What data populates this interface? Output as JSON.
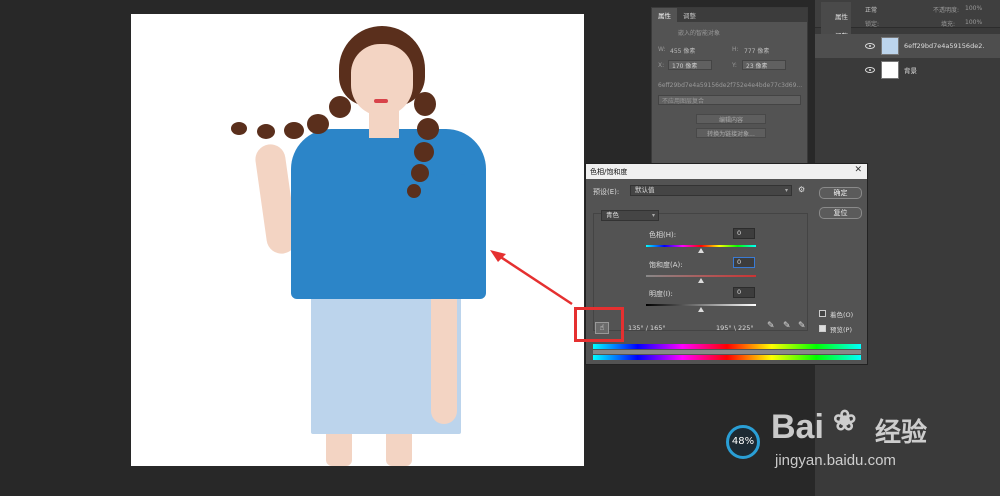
{
  "properties_panel": {
    "tabs": [
      "属性",
      "调整"
    ],
    "smart_object_label": "嵌入的智能对象",
    "w_label": "W:",
    "w_value": "455 像素",
    "h_label": "H:",
    "h_value": "777 像素",
    "x_label": "X:",
    "x_value": "170 像素",
    "y_label": "Y:",
    "y_value": "23 像素",
    "filename": "6eff29bd7e4a59156de2f752e4e4bde77c3d69...",
    "comp_placeholder": "不应用图层复合",
    "edit_contents": "编辑内容",
    "convert_layers": "转换为链接对象..."
  },
  "layers_panel": {
    "blend_mode": "正常",
    "opacity_label": "不透明度:",
    "opacity_value": "100%",
    "lock_label": "锁定:",
    "fill_label": "填充:",
    "fill_value": "100%",
    "layers": [
      {
        "name": "6eff29bd7e4a59156de2...",
        "selected": true
      },
      {
        "name": "背景",
        "selected": false
      }
    ],
    "adjust_tabs": [
      "属性",
      "调整"
    ]
  },
  "dialog": {
    "title": "色相/饱和度",
    "preset_label": "预设(E):",
    "preset_value": "默认值",
    "ok": "确定",
    "reset": "复位",
    "channel": "青色",
    "hue_label": "色相(H):",
    "hue_value": "0",
    "sat_label": "饱和度(A):",
    "sat_value": "0",
    "light_label": "明度(I):",
    "light_value": "0",
    "colorize": "着色(O)",
    "preview": "预览(P)",
    "range_left": "135° / 165°",
    "range_right": "195° \\ 225°",
    "colors": {
      "hue": "#ff0000",
      "accent": "#3a7bd5"
    }
  },
  "zoom": "48%",
  "watermark": {
    "brand": "Bai",
    "brand2": "经验",
    "url": "jingyan.baidu.com"
  },
  "icons": [
    "hand-target-icon",
    "eyedropper-icon",
    "eyedropper-plus-icon",
    "eyedropper-minus-icon",
    "gear-icon",
    "close-icon",
    "eye-icon"
  ]
}
